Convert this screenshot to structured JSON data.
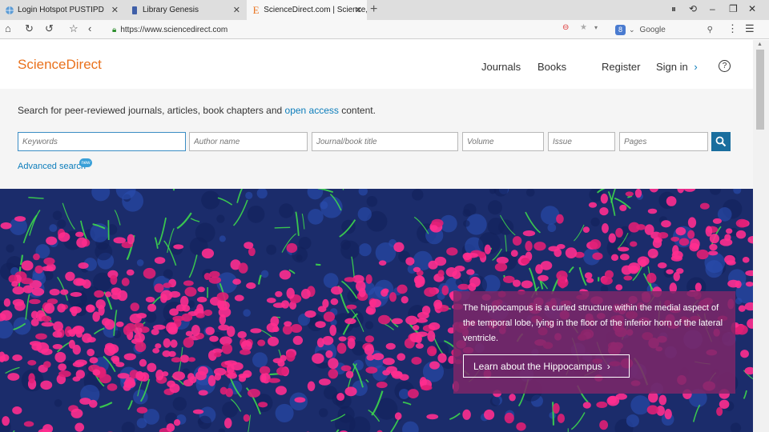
{
  "browser": {
    "tabs": [
      {
        "title": "Login Hotspot PUSTIPD",
        "icon": "globe-icon"
      },
      {
        "title": "Library Genesis",
        "icon": "library-icon"
      },
      {
        "title": "ScienceDirect.com | Science, h",
        "icon": "elsevier-icon"
      }
    ],
    "url": "https://www.sciencedirect.com",
    "search_engine": "Google"
  },
  "site": {
    "logo": "ScienceDirect",
    "nav": {
      "journals": "Journals",
      "books": "Books",
      "register": "Register",
      "signin": "Sign in"
    }
  },
  "search": {
    "intro_before": "Search for peer-reviewed journals, articles, book chapters and ",
    "intro_link": "open access",
    "intro_after": " content.",
    "placeholders": {
      "keywords": "Keywords",
      "author": "Author name",
      "journal": "Journal/book title",
      "volume": "Volume",
      "issue": "Issue",
      "pages": "Pages"
    },
    "advanced": "Advanced search",
    "new_badge": "new"
  },
  "hero": {
    "caption": "The hippocampus is a curled structure within the medial aspect of the temporal lobe, lying in the floor of the inferior horn of the lateral ventricle.",
    "button": "Learn about the Hippocampus"
  },
  "colors": {
    "brand": "#e9711c",
    "link": "#0c7dbb",
    "search_button": "#1a6e9e",
    "caption_bg": "#7d2669"
  }
}
